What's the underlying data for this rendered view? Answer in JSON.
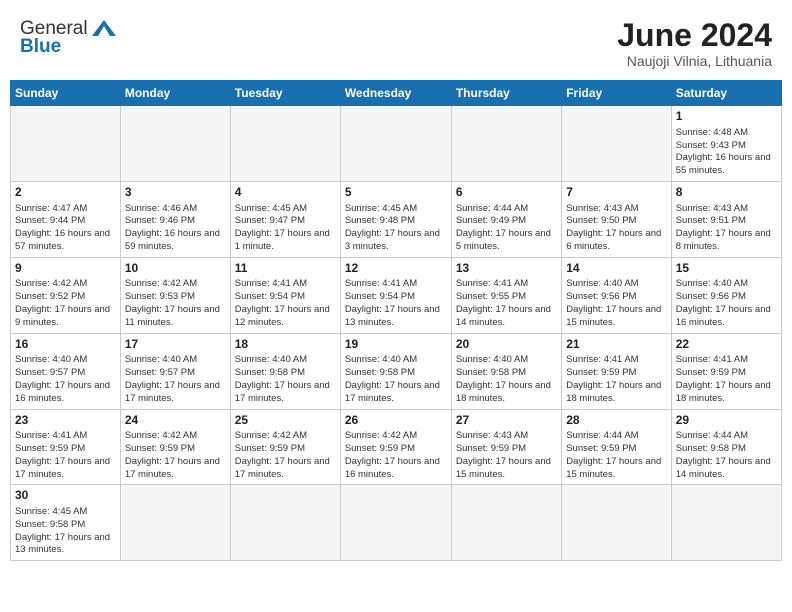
{
  "header": {
    "logo_general": "General",
    "logo_blue": "Blue",
    "month_title": "June 2024",
    "location": "Naujoji Vilnia, Lithuania"
  },
  "weekdays": [
    "Sunday",
    "Monday",
    "Tuesday",
    "Wednesday",
    "Thursday",
    "Friday",
    "Saturday"
  ],
  "weeks": [
    [
      {
        "day": "",
        "info": ""
      },
      {
        "day": "",
        "info": ""
      },
      {
        "day": "",
        "info": ""
      },
      {
        "day": "",
        "info": ""
      },
      {
        "day": "",
        "info": ""
      },
      {
        "day": "",
        "info": ""
      },
      {
        "day": "1",
        "info": "Sunrise: 4:48 AM\nSunset: 9:43 PM\nDaylight: 16 hours\nand 55 minutes."
      }
    ],
    [
      {
        "day": "2",
        "info": "Sunrise: 4:47 AM\nSunset: 9:44 PM\nDaylight: 16 hours\nand 57 minutes."
      },
      {
        "day": "3",
        "info": "Sunrise: 4:46 AM\nSunset: 9:46 PM\nDaylight: 16 hours\nand 59 minutes."
      },
      {
        "day": "4",
        "info": "Sunrise: 4:45 AM\nSunset: 9:47 PM\nDaylight: 17 hours\nand 1 minute."
      },
      {
        "day": "5",
        "info": "Sunrise: 4:45 AM\nSunset: 9:48 PM\nDaylight: 17 hours\nand 3 minutes."
      },
      {
        "day": "6",
        "info": "Sunrise: 4:44 AM\nSunset: 9:49 PM\nDaylight: 17 hours\nand 5 minutes."
      },
      {
        "day": "7",
        "info": "Sunrise: 4:43 AM\nSunset: 9:50 PM\nDaylight: 17 hours\nand 6 minutes."
      },
      {
        "day": "8",
        "info": "Sunrise: 4:43 AM\nSunset: 9:51 PM\nDaylight: 17 hours\nand 8 minutes."
      }
    ],
    [
      {
        "day": "9",
        "info": "Sunrise: 4:42 AM\nSunset: 9:52 PM\nDaylight: 17 hours\nand 9 minutes."
      },
      {
        "day": "10",
        "info": "Sunrise: 4:42 AM\nSunset: 9:53 PM\nDaylight: 17 hours\nand 11 minutes."
      },
      {
        "day": "11",
        "info": "Sunrise: 4:41 AM\nSunset: 9:54 PM\nDaylight: 17 hours\nand 12 minutes."
      },
      {
        "day": "12",
        "info": "Sunrise: 4:41 AM\nSunset: 9:54 PM\nDaylight: 17 hours\nand 13 minutes."
      },
      {
        "day": "13",
        "info": "Sunrise: 4:41 AM\nSunset: 9:55 PM\nDaylight: 17 hours\nand 14 minutes."
      },
      {
        "day": "14",
        "info": "Sunrise: 4:40 AM\nSunset: 9:56 PM\nDaylight: 17 hours\nand 15 minutes."
      },
      {
        "day": "15",
        "info": "Sunrise: 4:40 AM\nSunset: 9:56 PM\nDaylight: 17 hours\nand 16 minutes."
      }
    ],
    [
      {
        "day": "16",
        "info": "Sunrise: 4:40 AM\nSunset: 9:57 PM\nDaylight: 17 hours\nand 16 minutes."
      },
      {
        "day": "17",
        "info": "Sunrise: 4:40 AM\nSunset: 9:57 PM\nDaylight: 17 hours\nand 17 minutes."
      },
      {
        "day": "18",
        "info": "Sunrise: 4:40 AM\nSunset: 9:58 PM\nDaylight: 17 hours\nand 17 minutes."
      },
      {
        "day": "19",
        "info": "Sunrise: 4:40 AM\nSunset: 9:58 PM\nDaylight: 17 hours\nand 17 minutes."
      },
      {
        "day": "20",
        "info": "Sunrise: 4:40 AM\nSunset: 9:58 PM\nDaylight: 17 hours\nand 18 minutes."
      },
      {
        "day": "21",
        "info": "Sunrise: 4:41 AM\nSunset: 9:59 PM\nDaylight: 17 hours\nand 18 minutes."
      },
      {
        "day": "22",
        "info": "Sunrise: 4:41 AM\nSunset: 9:59 PM\nDaylight: 17 hours\nand 18 minutes."
      }
    ],
    [
      {
        "day": "23",
        "info": "Sunrise: 4:41 AM\nSunset: 9:59 PM\nDaylight: 17 hours\nand 17 minutes."
      },
      {
        "day": "24",
        "info": "Sunrise: 4:42 AM\nSunset: 9:59 PM\nDaylight: 17 hours\nand 17 minutes."
      },
      {
        "day": "25",
        "info": "Sunrise: 4:42 AM\nSunset: 9:59 PM\nDaylight: 17 hours\nand 17 minutes."
      },
      {
        "day": "26",
        "info": "Sunrise: 4:42 AM\nSunset: 9:59 PM\nDaylight: 17 hours\nand 16 minutes."
      },
      {
        "day": "27",
        "info": "Sunrise: 4:43 AM\nSunset: 9:59 PM\nDaylight: 17 hours\nand 15 minutes."
      },
      {
        "day": "28",
        "info": "Sunrise: 4:44 AM\nSunset: 9:59 PM\nDaylight: 17 hours\nand 15 minutes."
      },
      {
        "day": "29",
        "info": "Sunrise: 4:44 AM\nSunset: 9:58 PM\nDaylight: 17 hours\nand 14 minutes."
      }
    ],
    [
      {
        "day": "30",
        "info": "Sunrise: 4:45 AM\nSunset: 9:58 PM\nDaylight: 17 hours\nand 13 minutes."
      },
      {
        "day": "",
        "info": ""
      },
      {
        "day": "",
        "info": ""
      },
      {
        "day": "",
        "info": ""
      },
      {
        "day": "",
        "info": ""
      },
      {
        "day": "",
        "info": ""
      },
      {
        "day": "",
        "info": ""
      }
    ]
  ]
}
